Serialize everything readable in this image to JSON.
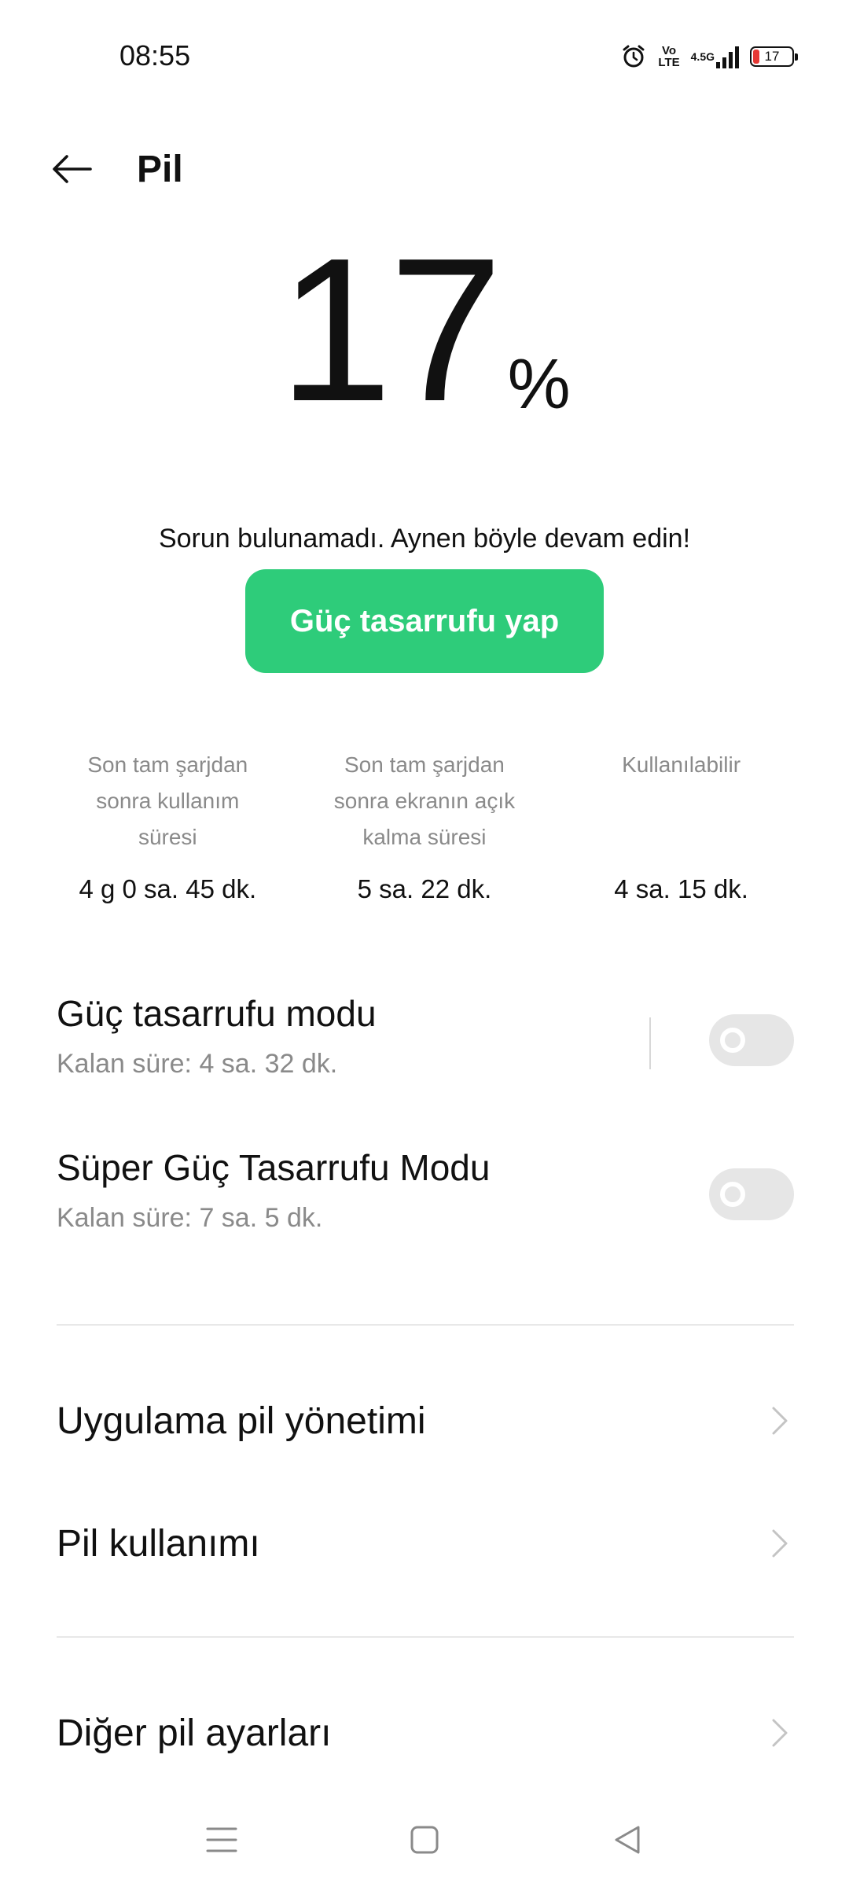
{
  "status_bar": {
    "time": "08:55",
    "volte_label": "Vo LTE",
    "network_label": "4.5G",
    "battery_level": "17",
    "battery_fraction": 0.17
  },
  "header": {
    "title": "Pil",
    "back_icon": "arrow-left-icon"
  },
  "battery": {
    "percent": "17",
    "percent_sign": "%"
  },
  "message": "Sorun bulunamadı. Aynen böyle devam edin!",
  "save_button_label": "Güç tasarrufu yap",
  "stats": [
    {
      "label": "Son tam şarjdan sonra kullanım süresi",
      "value": "4 g 0 sa. 45 dk."
    },
    {
      "label": "Son tam şarjdan sonra ekranın açık kalma süresi",
      "value": "5 sa. 22 dk."
    },
    {
      "label": "Kullanılabilir",
      "value": "4 sa. 15 dk."
    }
  ],
  "modes": [
    {
      "title": "Güç tasarrufu modu",
      "subtitle": "Kalan süre:  4 sa. 32 dk.",
      "enabled": false
    },
    {
      "title": "Süper Güç Tasarrufu Modu",
      "subtitle": "Kalan süre:  7 sa. 5 dk.",
      "enabled": false
    }
  ],
  "nav_items": [
    {
      "label": "Uygulama pil yönetimi"
    },
    {
      "label": "Pil kullanımı"
    },
    {
      "label": "Diğer pil ayarları"
    }
  ],
  "colors": {
    "accent": "#2ecc7a",
    "battery_low": "#e53935",
    "secondary_text": "#8a8a8a"
  },
  "system_nav": {
    "menu_icon": "menu-icon",
    "home_icon": "home-square-icon",
    "back_icon": "back-triangle-icon"
  }
}
